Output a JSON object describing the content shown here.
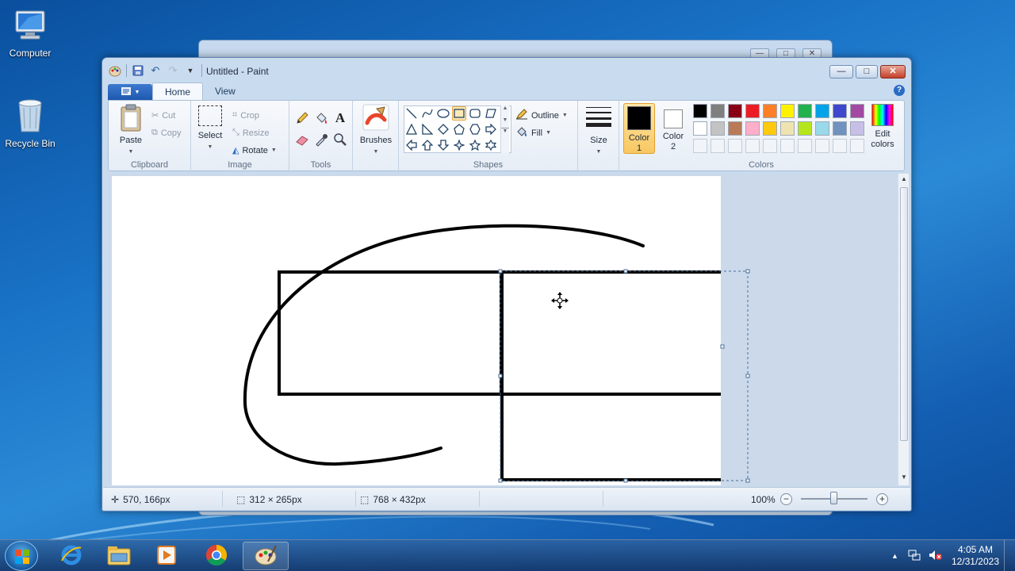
{
  "desktop": {
    "icons": [
      {
        "label": "Computer",
        "icon": "computer-icon"
      },
      {
        "label": "Recycle Bin",
        "icon": "recycle-bin-icon"
      }
    ]
  },
  "window": {
    "title": "Untitled - Paint",
    "controls": {
      "minimize": "—",
      "maximize": "□",
      "close": "✕"
    }
  },
  "ribbon": {
    "file_tab_icon": "file-menu-icon",
    "tabs": [
      "Home",
      "View"
    ],
    "active_tab": "Home",
    "help": "?",
    "groups": {
      "clipboard": {
        "label": "Clipboard",
        "paste": "Paste",
        "cut": "Cut",
        "copy": "Copy"
      },
      "image": {
        "label": "Image",
        "select": "Select",
        "crop": "Crop",
        "resize": "Resize",
        "rotate": "Rotate"
      },
      "tools": {
        "label": "Tools"
      },
      "brushes": {
        "label": "Brushes"
      },
      "shapes": {
        "label": "Shapes",
        "outline": "Outline",
        "fill": "Fill"
      },
      "size": {
        "label": "Size"
      },
      "colors": {
        "label": "Colors",
        "color1": "Color\n1",
        "color1_a": "Color",
        "color1_b": "1",
        "color2_a": "Color",
        "color2_b": "2",
        "edit_a": "Edit",
        "edit_b": "colors",
        "color1_value": "#000000",
        "color2_value": "#ffffff",
        "palette_row1": [
          "#000000",
          "#7f7f7f",
          "#880015",
          "#ed1c24",
          "#ff7f27",
          "#fff200",
          "#22b14c",
          "#00a2e8",
          "#3f48cc",
          "#a349a4"
        ],
        "palette_row2": [
          "#ffffff",
          "#c3c3c3",
          "#b97a57",
          "#ffaec9",
          "#ffc90e",
          "#efe4b0",
          "#b5e61d",
          "#99d9ea",
          "#7092be",
          "#c8bfe7"
        ]
      }
    }
  },
  "status": {
    "cursor_pos": "570, 166px",
    "selection_size": "312 × 265px",
    "image_size": "768 × 432px",
    "zoom": "100%"
  },
  "taskbar": {
    "apps": [
      "internet-explorer-icon",
      "file-explorer-icon",
      "media-player-icon",
      "chrome-icon",
      "paint-icon"
    ],
    "time": "4:05 AM",
    "date": "12/31/2023"
  }
}
